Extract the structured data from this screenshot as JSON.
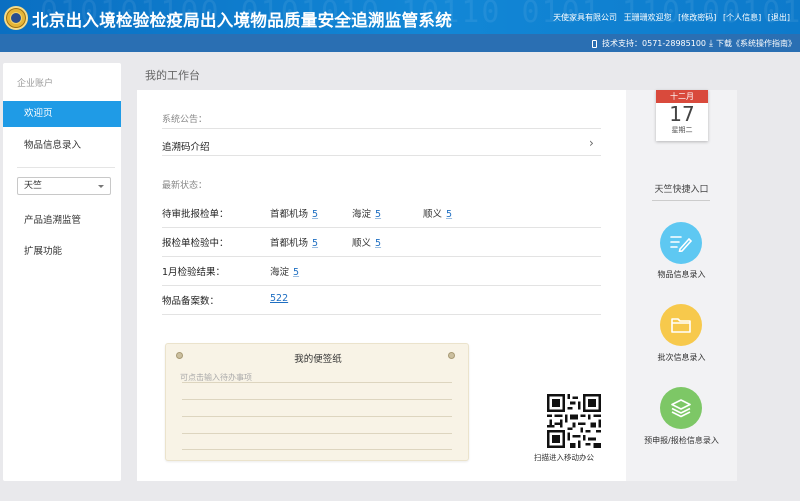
{
  "header": {
    "title": "北京出入境检验检疫局出入境物品质量安全追溯监管系统",
    "watermark": "010101100 0101010 10110 0101 11010010110",
    "company": "天使家具有限公司",
    "welcome": "王珊珊欢迎您",
    "change_password": "[修改密码]",
    "personal_info": "[个人信息]",
    "logout": "[退出]",
    "support": "技术支持：0571-28985100",
    "download": "下载《系统操作指南》"
  },
  "sidebar": {
    "section_label": "企业账户",
    "items": [
      {
        "label": "欢迎页",
        "active": true
      },
      {
        "label": "物品信息录入",
        "active": false
      }
    ],
    "select_value": "天竺",
    "items2": [
      {
        "label": "产品追溯监管"
      },
      {
        "label": "扩展功能"
      }
    ]
  },
  "main": {
    "page_title": "我的工作台",
    "announcement_label": "系统公告：",
    "announcement_link": "追溯码介绍",
    "status_label": "最新状态：",
    "status_rows": [
      {
        "label": "待审批报检单：",
        "items": [
          {
            "name": "首都机场",
            "count": "5"
          },
          {
            "name": "海淀",
            "count": "5"
          },
          {
            "name": "顺义",
            "count": "5"
          }
        ]
      },
      {
        "label": "报检单检验中：",
        "items": [
          {
            "name": "首都机场",
            "count": "5"
          },
          {
            "name": "顺义",
            "count": "5"
          }
        ]
      },
      {
        "label": "1月检验结果：",
        "items": [
          {
            "name": "海淀",
            "count": "5"
          }
        ]
      },
      {
        "label": "物品备案数：",
        "value": "522"
      }
    ],
    "memo": {
      "title": "我的便签纸",
      "placeholder": "可点击输入待办事项"
    },
    "qr_caption": "扫描进入移动办公"
  },
  "right": {
    "calendar": {
      "month": "十二月",
      "day": "17",
      "weekday": "星期二"
    },
    "quick_title": "天竺快捷入口",
    "quick": [
      {
        "label": "物品信息录入",
        "color": "#5ec8f2",
        "icon": "edit-icon"
      },
      {
        "label": "批次信息录入",
        "color": "#f7c94c",
        "icon": "folder-icon"
      },
      {
        "label": "预申报/报检信息录入",
        "color": "#7dc766",
        "icon": "layers-icon"
      }
    ]
  },
  "colors": {
    "header": "#1287d6",
    "subbar": "#2a6fb3",
    "active": "#1f9be6",
    "link": "#1f6fc2",
    "calendar_red": "#d94a3c"
  }
}
